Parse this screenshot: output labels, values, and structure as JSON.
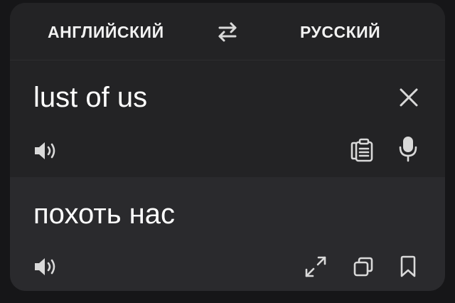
{
  "languages": {
    "source": "АНГЛИЙСКИЙ",
    "target": "РУССКИЙ"
  },
  "source": {
    "text": "lust of us"
  },
  "translation": {
    "text": "похоть нас"
  },
  "icons": {
    "swap": "swap-arrows-icon",
    "clear": "close-icon",
    "speaker": "speaker-icon",
    "paste": "clipboard-icon",
    "mic": "microphone-icon",
    "expand": "expand-icon",
    "copy": "copy-icon",
    "bookmark": "bookmark-icon"
  },
  "colors": {
    "background": "#161618",
    "card": "#232325",
    "translation_panel": "#2a2a2d",
    "text": "#ffffff",
    "icon": "#d9d9d9"
  }
}
